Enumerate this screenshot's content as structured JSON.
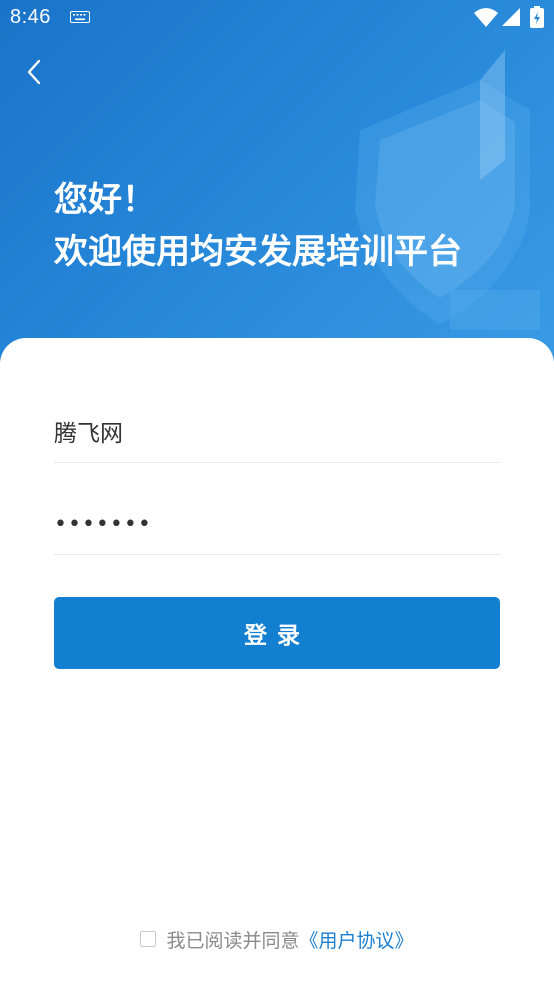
{
  "status_bar": {
    "time": "8:46"
  },
  "header": {
    "greeting_line1": "您好！",
    "greeting_line2": "欢迎使用均安发展培训平台"
  },
  "form": {
    "username_value": "腾飞网",
    "password_value": "•••••••",
    "login_label": "登录"
  },
  "agreement": {
    "text": "我已阅读并同意",
    "link": "《用户协议》",
    "checked": false
  },
  "colors": {
    "primary": "#137fd0",
    "hero_start": "#1a74c9",
    "link": "#1a7fd1"
  },
  "icons": [
    "back-arrow-icon",
    "keyboard-icon",
    "wifi-icon",
    "signal-icon",
    "battery-icon"
  ]
}
